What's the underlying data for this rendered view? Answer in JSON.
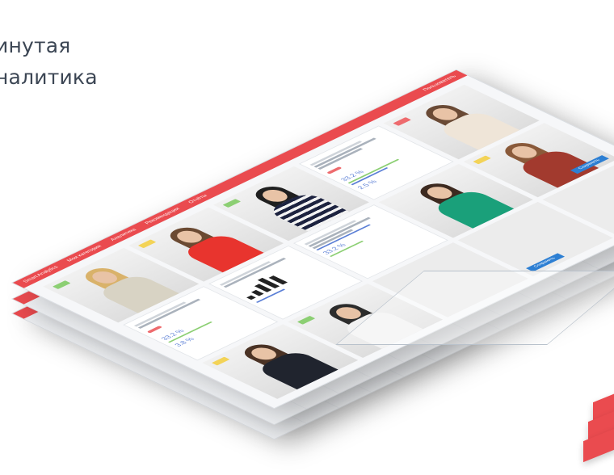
{
  "hero": {
    "line1": "инутая",
    "line2": "налитика"
  },
  "app": {
    "brand": "Smart Analytics",
    "tabs": [
      "Мои категории",
      "Аналитика",
      "Рекомендации",
      "Отчёты"
    ],
    "user": "Пользователь",
    "cards": [
      {
        "stat": "33.2 %",
        "stat2": "2.5 %"
      },
      {
        "stat": "33.2 %",
        "stat2": "3.8 %"
      },
      {
        "stat": "33.2 %",
        "stat2": ""
      }
    ],
    "button_label": "Сохранить",
    "button_label2": "Сохранить"
  },
  "colors": {
    "accent": "#ea4b4f",
    "blue": "#2d7fd3",
    "text": "#3c4654"
  }
}
